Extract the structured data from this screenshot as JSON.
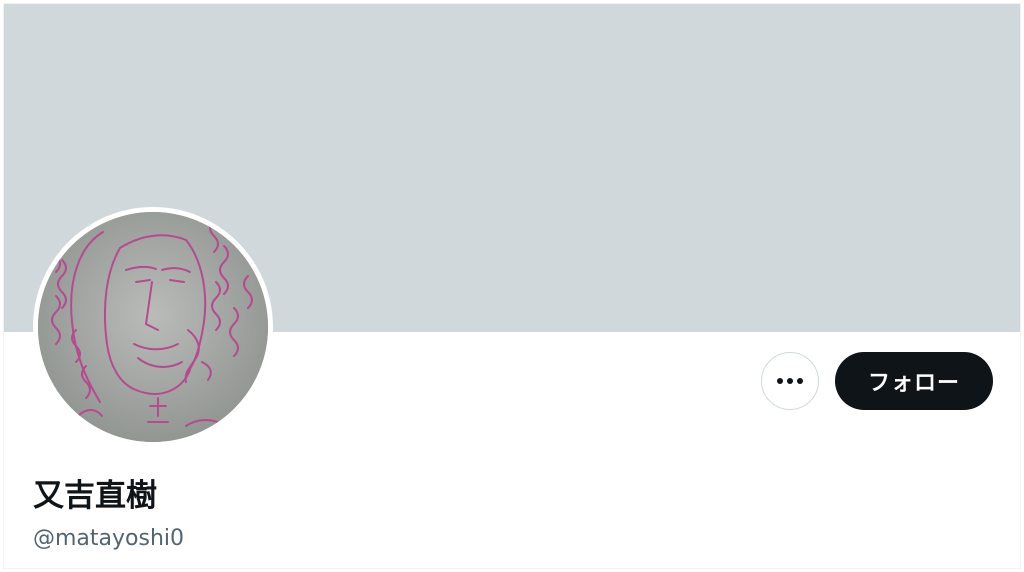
{
  "profile": {
    "display_name": "又吉直樹",
    "handle": "@matayoshi0",
    "avatar_icon": "hand-drawn-portrait-avatar",
    "banner_color": "#d1d8db"
  },
  "actions": {
    "more_icon": "more-dots-icon",
    "follow_label": "フォロー"
  }
}
